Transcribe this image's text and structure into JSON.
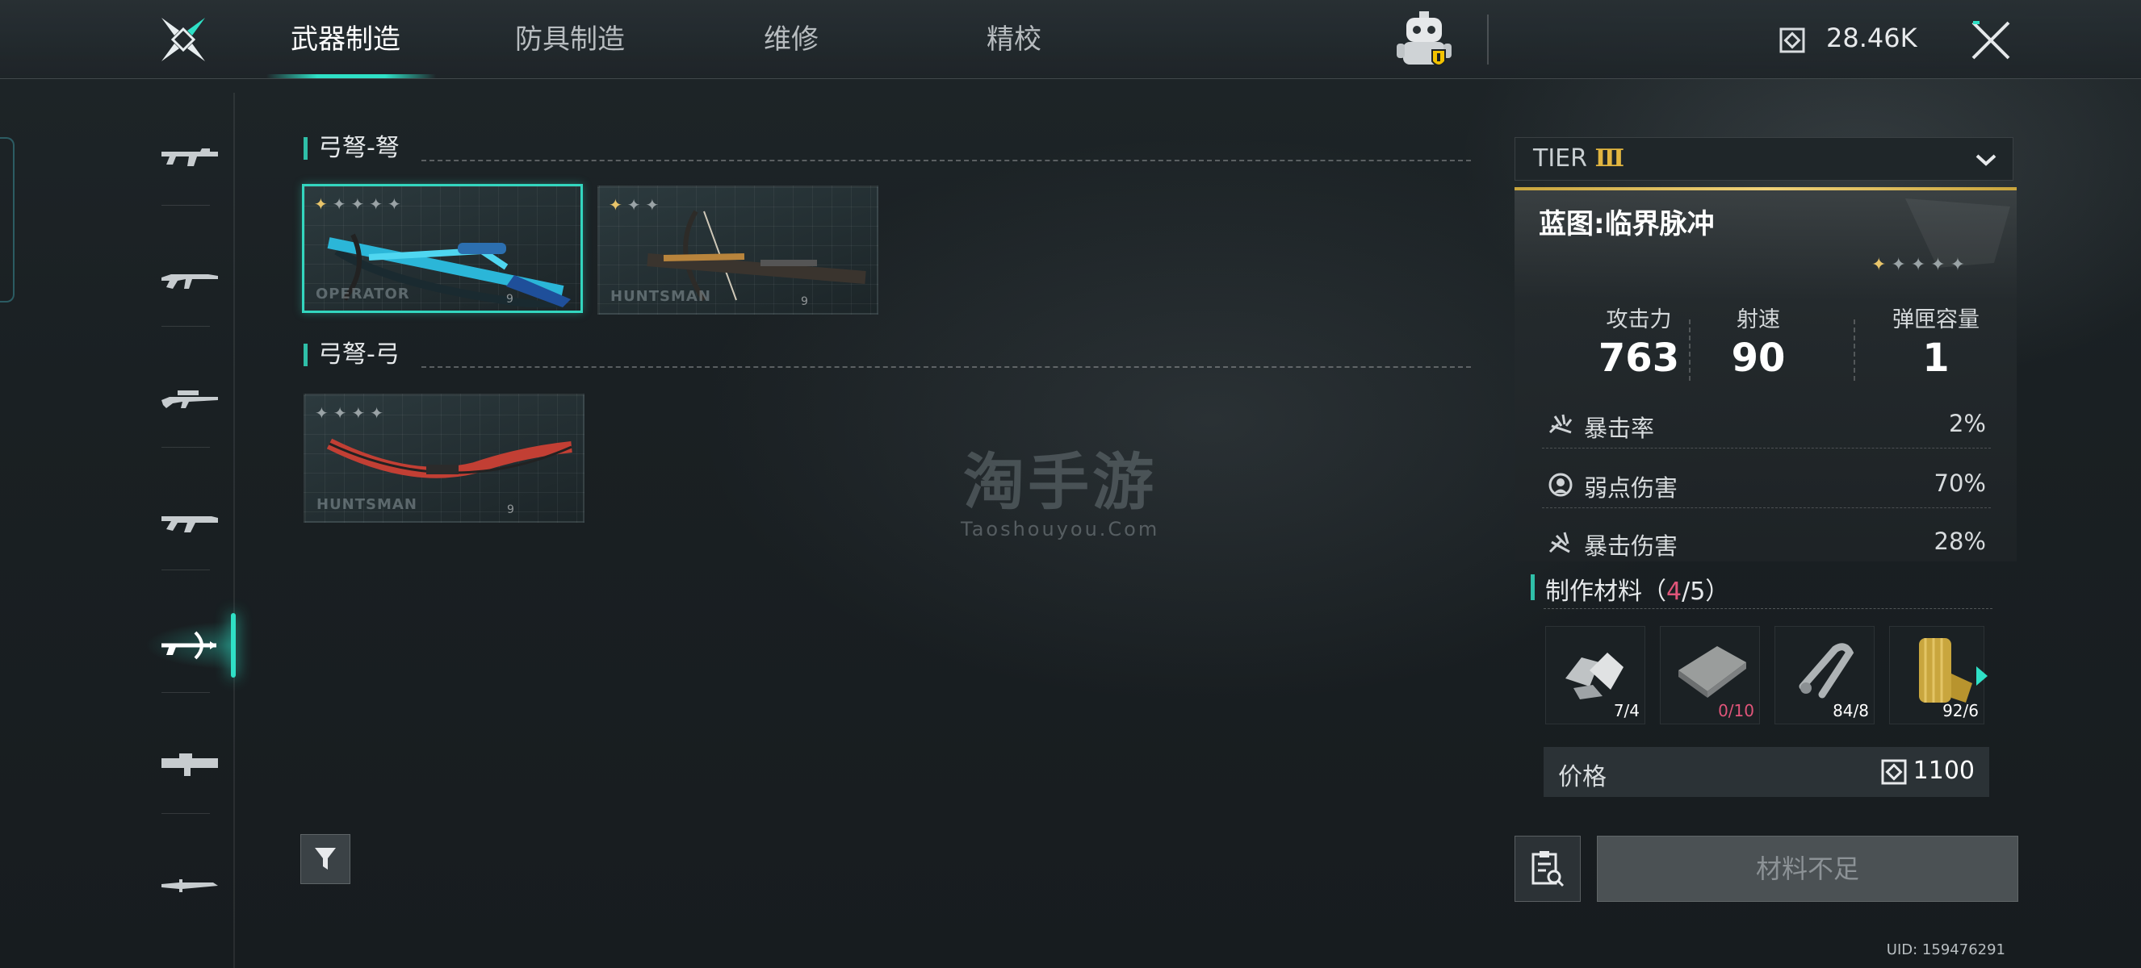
{
  "header": {
    "tabs": [
      {
        "label": "武器制造",
        "active": true
      },
      {
        "label": "防具制造",
        "active": false
      },
      {
        "label": "维修",
        "active": false
      },
      {
        "label": "精校",
        "active": false
      }
    ],
    "currency_value": "28.46K"
  },
  "sidebar": {
    "items": [
      {
        "icon": "smg-icon",
        "active": false
      },
      {
        "icon": "rifle-icon",
        "active": false
      },
      {
        "icon": "sniper-icon",
        "active": false
      },
      {
        "icon": "shotgun-icon",
        "active": false
      },
      {
        "icon": "crossbow-icon",
        "active": true
      },
      {
        "icon": "launcher-icon",
        "active": false
      },
      {
        "icon": "knife-icon",
        "active": false
      }
    ]
  },
  "sections": [
    {
      "title": "弓弩-弩",
      "cards": [
        {
          "stars_lit": 1,
          "stars_total": 5,
          "brand": "OPERATOR",
          "num": "9",
          "selected": true
        },
        {
          "stars_lit": 1,
          "stars_total": 3,
          "brand": "HUNTSMAN",
          "num": "9",
          "selected": false
        }
      ]
    },
    {
      "title": "弓弩-弓",
      "cards": [
        {
          "stars_lit": 0,
          "stars_total": 4,
          "brand": "HUNTSMAN",
          "num": "9",
          "selected": false
        }
      ]
    }
  ],
  "watermark": {
    "main": "淘手游",
    "sub": "Taoshouyou.Com"
  },
  "detail": {
    "tier_prefix": "TIER",
    "tier_roman": "Ⅲ",
    "blueprint_title": "蓝图:临界脉冲",
    "stars_lit": 1,
    "stars_total": 5,
    "stats": [
      {
        "label": "攻击力",
        "value": "763"
      },
      {
        "label": "射速",
        "value": "90"
      },
      {
        "label": "弹匣容量",
        "value": "1"
      }
    ],
    "sub_stats": [
      {
        "icon": "crit-rate-icon",
        "label": "暴击率",
        "value": "2%"
      },
      {
        "icon": "weakpoint-icon",
        "label": "弱点伤害",
        "value": "70%"
      },
      {
        "icon": "crit-damage-icon",
        "label": "暴击伤害",
        "value": "28%"
      }
    ],
    "materials_label": "制作材料（",
    "materials_have": "4",
    "materials_sep": "/5）",
    "materials": [
      {
        "icon": "metal-scrap-icon",
        "count": "7/4",
        "short": false
      },
      {
        "icon": "steel-plate-icon",
        "count": "0/10",
        "short": true
      },
      {
        "icon": "shackle-icon",
        "count": "84/8",
        "short": false
      },
      {
        "icon": "cloth-roll-icon",
        "count": "92/6",
        "short": false
      }
    ],
    "price_label": "价格",
    "price_value": "1100",
    "craft_button": "材料不足"
  },
  "footer": {
    "uid": "UID: 159476291"
  },
  "colors": {
    "accent": "#2fe0c6",
    "tier_gold": "#e2b640",
    "shortage": "#e0557a"
  }
}
